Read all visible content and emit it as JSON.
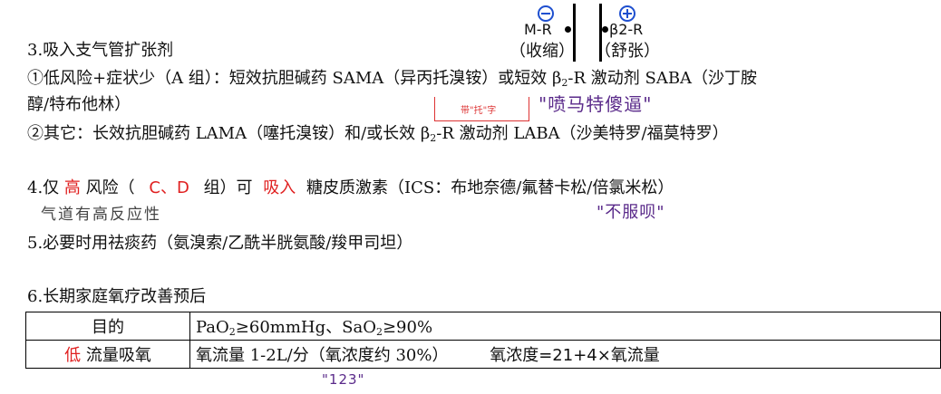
{
  "receptor_diagram": {
    "left": {
      "sign": "minus",
      "label": "M-R",
      "effect": "（收缩）"
    },
    "right": {
      "sign": "plus",
      "label": "β2-R",
      "effect": "（舒张）"
    }
  },
  "s3": {
    "heading": "3.吸入支气管扩张剂",
    "item1_l1": "①低风险+症状少（A 组）：短效抗胆碱药 SAMA（异丙托溴铵）或短效 β",
    "item1_sub": "2",
    "item1_l1b": "-R 激动剂 SABA（沙丁胺",
    "item1_l2": "醇/特布他林）",
    "bracket_note": "带\"托\"字",
    "mnemonic": "\"喷马特傻逼\"",
    "item2_a": "②其它：长效抗胆碱药 LAMA（噻托溴铵）和/或长效 β",
    "item2_sub": "2",
    "item2_b": "-R 激动剂 LABA（沙美特罗/福莫特罗）"
  },
  "s4": {
    "p1": "4.仅",
    "high": "高",
    "p2": "风险（",
    "groups": "C、D",
    "p3": "组）可",
    "inhale": "吸入",
    "p4": "糖皮质激素（ICS：布地奈德/氟替卡松/倍氯米松）",
    "note": "气道有高反应性",
    "mnemonic": "\"不服呗\""
  },
  "s5": {
    "text": "5.必要时用祛痰药（氨溴索/乙酰半胱氨酸/羧甲司坦）"
  },
  "s6": {
    "heading": "6.长期家庭氧疗改善预后",
    "row1_label": "目的",
    "row1_v1": "PaO",
    "row1_s1": "2",
    "row1_v2": "≥60mmHg、SaO",
    "row1_s2": "2",
    "row1_v3": "≥90%",
    "row2_low": "低",
    "row2_label": "流量吸氧",
    "row2_value": "氧流量 1-2L/分（氧浓度约 30%）",
    "row2_formula": "氧浓度=21+4×氧流量",
    "note_123": "\"123\""
  },
  "colors": {
    "red": "#e02020",
    "purple": "#5a2a8a",
    "blue": "#1e4fcf"
  }
}
